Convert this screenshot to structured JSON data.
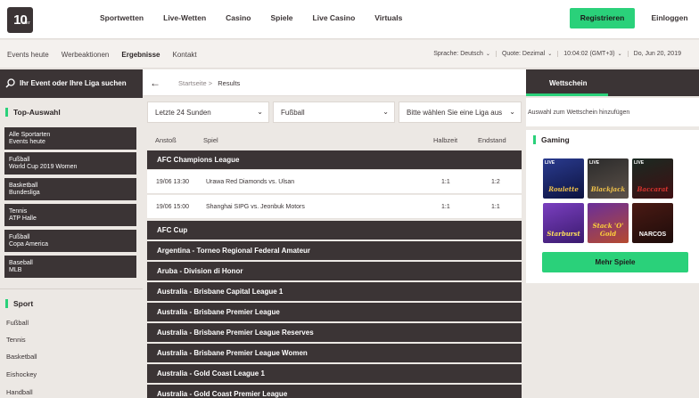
{
  "header": {
    "logo_text": "10",
    "logo_sub": "BET",
    "nav": [
      "Sportwetten",
      "Live-Wetten",
      "Casino",
      "Spiele",
      "Live Casino",
      "Virtuals"
    ],
    "register_label": "Registrieren",
    "login_label": "Einloggen"
  },
  "subheader": {
    "nav": [
      "Events heute",
      "Werbeaktionen",
      "Ergebnisse",
      "Kontakt"
    ],
    "language_label": "Sprache:",
    "language_value": "Deutsch",
    "odds_label": "Quote:",
    "odds_value": "Dezimal",
    "time": "10:04:02",
    "timezone": "(GMT+3)",
    "date": "Do, Jun 20, 2019"
  },
  "sidebar": {
    "search_placeholder": "Ihr Event oder Ihre Liga suchen",
    "top_title": "Top-Auswahl",
    "top_items": [
      {
        "line1": "Alle Sportarten",
        "line2": "Events heute"
      },
      {
        "line1": "Fußball",
        "line2": "World Cup 2019 Women"
      },
      {
        "line1": "Basketball",
        "line2": "Bundesliga"
      },
      {
        "line1": "Tennis",
        "line2": "ATP Halle"
      },
      {
        "line1": "Fußball",
        "line2": "Copa America"
      },
      {
        "line1": "Baseball",
        "line2": "MLB"
      }
    ],
    "sport_title": "Sport",
    "sports": [
      "Fußball",
      "Tennis",
      "Basketball",
      "Eishockey",
      "Handball"
    ]
  },
  "main": {
    "breadcrumb_home": "Startseite",
    "breadcrumb_sep": ">",
    "breadcrumb_current": "Results",
    "filter_period": "Letzte 24 Sunden",
    "filter_sport": "Fußball",
    "filter_league": "Bitte wählen Sie eine Liga aus",
    "columns": {
      "start": "Anstoß",
      "game": "Spiel",
      "half": "Halbzeit",
      "final": "Endstand"
    },
    "leagues": [
      "AFC Champions League",
      "AFC Cup",
      "Argentina - Torneo Regional Federal Amateur",
      "Aruba - Division di Honor",
      "Australia - Brisbane Capital League 1",
      "Australia - Brisbane Premier League",
      "Australia - Brisbane Premier League Reserves",
      "Australia - Brisbane Premier League Women",
      "Australia - Gold Coast League 1",
      "Australia - Gold Coast Premier League"
    ],
    "matches": [
      {
        "time": "19/06 13:30",
        "game": "Urawa Red Diamonds vs. Ulsan",
        "half": "1:1",
        "final": "1:2"
      },
      {
        "time": "19/06 15:00",
        "game": "Shanghai SIPG vs. Jeonbuk Motors",
        "half": "1:1",
        "final": "1:1"
      }
    ]
  },
  "betslip": {
    "tab_label": "Wettschein",
    "empty_text": "Auswahl zum Wettschein hinzufügen"
  },
  "gaming": {
    "title": "Gaming",
    "live_label": "LIVE",
    "games": [
      "Roulette",
      "Blackjack",
      "Baccarat",
      "Starburst",
      "Stack 'O' Gold",
      "NARCOS"
    ],
    "more_label": "Mehr Spiele"
  },
  "colors": {
    "dark": "#3b3435",
    "accent": "#2ad17a",
    "background": "#ece8e4"
  }
}
